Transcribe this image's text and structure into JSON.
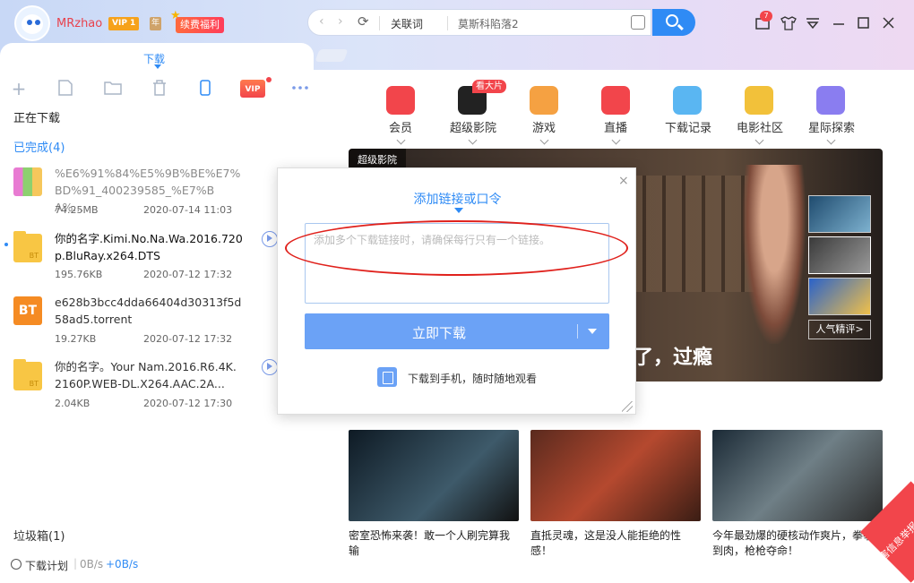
{
  "user": {
    "name": "MRzhao",
    "vip_label": "VIP 1",
    "year_label": "年",
    "renew_label": "续费福利"
  },
  "search": {
    "keyword_type": "关联词",
    "keyword_value": "莫斯科陷落2"
  },
  "header": {
    "message_count": "7"
  },
  "tabs": {
    "download": "下载"
  },
  "sidebar": {
    "downloading": "正在下载",
    "completed": "已完成(4)",
    "trash": "垃圾箱(1)",
    "items": [
      {
        "name": "%E6%91%84%E5%9B%BE%E7%BD%91_400239585_%E7%BA%...",
        "size": "74.25MB",
        "date": "2020-07-14 11:03",
        "type": "archive"
      },
      {
        "name": "你的名字.Kimi.No.Na.Wa.2016.720p.BluRay.x264.DTS",
        "size": "195.76KB",
        "date": "2020-07-12 17:32",
        "type": "folder"
      },
      {
        "name": "e628b3bcc4dda66404d30313f5d58ad5.torrent",
        "size": "19.27KB",
        "date": "2020-07-12 17:32",
        "type": "bt"
      },
      {
        "name": "你的名字。Your Nam.2016.R6.4K.2160P.WEB-DL.X264.AAC.2A...",
        "size": "2.04KB",
        "date": "2020-07-12 17:30",
        "type": "folder"
      }
    ]
  },
  "status": {
    "plan": "下载计划",
    "down_speed": "0B/s",
    "up_speed": "+0B/s"
  },
  "categories": [
    {
      "label": "会员",
      "color": "#f2454b"
    },
    {
      "label": "超级影院",
      "color": "#222222"
    },
    {
      "label": "游戏",
      "color": "#f5a142"
    },
    {
      "label": "直播",
      "color": "#f2454b"
    },
    {
      "label": "下载记录",
      "color": "#5ab6f2"
    },
    {
      "label": "电影社区",
      "color": "#f2c13a"
    },
    {
      "label": "星际探索",
      "color": "#8a7df0"
    }
  ],
  "hot_tag": "看大片",
  "banner": {
    "tag": "超级影院",
    "caption": "了，过瘾",
    "popular": "人气精评>"
  },
  "cards": [
    {
      "text": "密室恐怖来袭！敢一个人刷完算我输"
    },
    {
      "text": "直抵灵魂，这是没人能拒绝的性感！"
    },
    {
      "text": "今年最劲爆的硬核动作爽片，拳拳到肉，枪枪夺命！"
    }
  ],
  "corner": {
    "text": "有害信息举报"
  },
  "dialog": {
    "title": "添加链接或口令",
    "placeholder": "添加多个下载链接时，请确保每行只有一个链接。",
    "download_button": "立即下载",
    "phone_text": "下载到手机，随时随地观看"
  }
}
